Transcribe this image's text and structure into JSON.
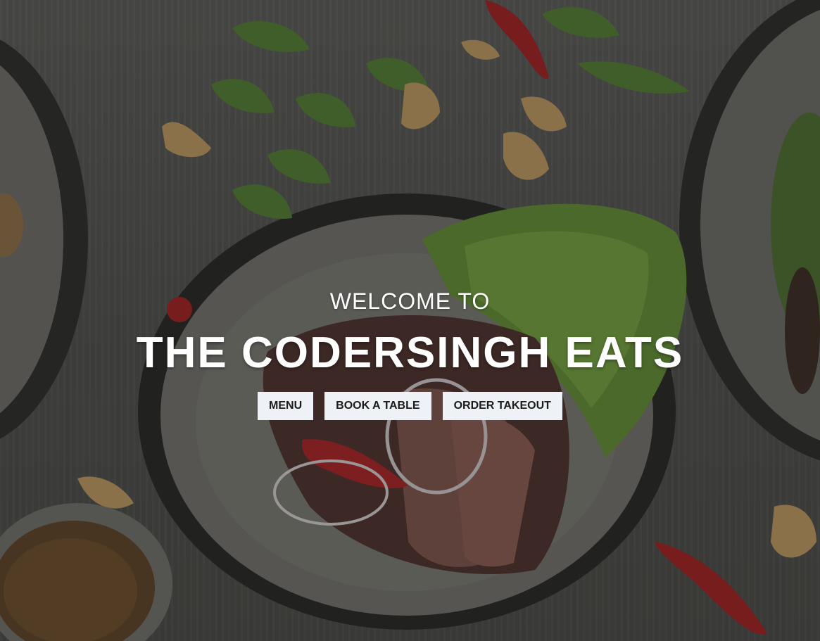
{
  "hero": {
    "welcome": "WELCOME TO",
    "title": "THE CODERSINGH EATS"
  },
  "buttons": {
    "menu": "MENU",
    "book": "BOOK A TABLE",
    "takeout": "ORDER TAKEOUT"
  },
  "colors": {
    "button_bg": "#eef1f5",
    "button_text": "#1b1b1b",
    "heading_text": "#ffffff"
  }
}
